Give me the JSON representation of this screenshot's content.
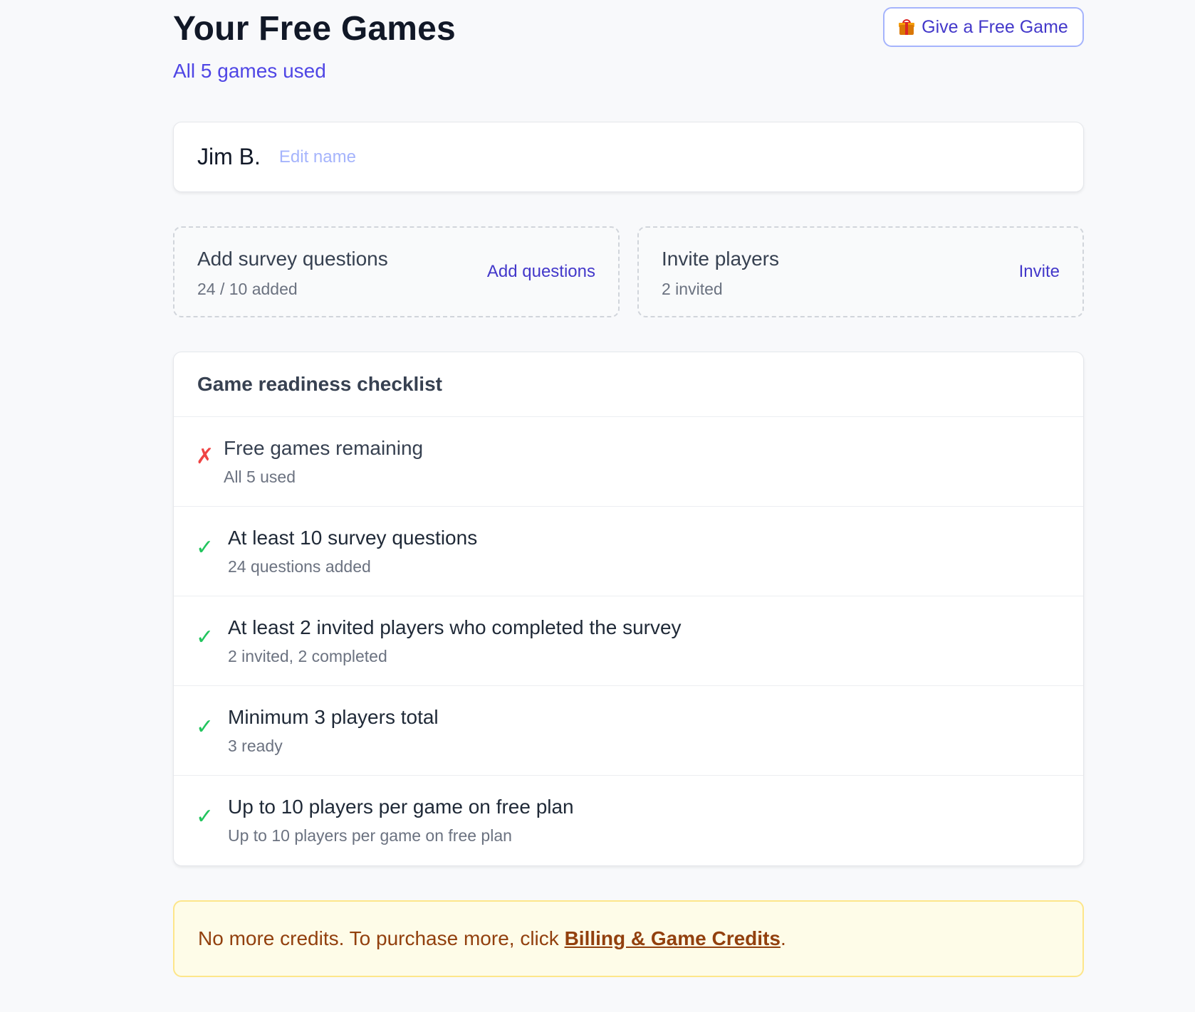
{
  "header": {
    "title": "Your Free Games",
    "subtitle": "All 5 games used",
    "give_button_label": "Give a Free Game",
    "give_button_icon": "gift-icon"
  },
  "player": {
    "name": "Jim B.",
    "edit_label": "Edit name"
  },
  "tiles": [
    {
      "title": "Add survey questions",
      "subtitle": "24 / 10 added",
      "action": "Add questions"
    },
    {
      "title": "Invite players",
      "subtitle": "2 invited",
      "action": "Invite"
    }
  ],
  "checklist": {
    "heading": "Game readiness checklist",
    "items": [
      {
        "status": "fail",
        "mark": "✗",
        "title": "Free games remaining",
        "detail": "All 5 used"
      },
      {
        "status": "pass",
        "mark": "✓",
        "title": "At least 10 survey questions",
        "detail": "24 questions added"
      },
      {
        "status": "pass",
        "mark": "✓",
        "title": "At least 2 invited players who completed the survey",
        "detail": "2 invited, 2 completed"
      },
      {
        "status": "pass",
        "mark": "✓",
        "title": "Minimum 3 players total",
        "detail": "3 ready"
      },
      {
        "status": "pass",
        "mark": "✓",
        "title": "Up to 10 players per game on free plan",
        "detail": "Up to 10 players per game on free plan"
      }
    ]
  },
  "notice": {
    "text_before": "No more credits. To purchase more, click ",
    "link_label": "Billing & Game Credits",
    "text_after": "."
  },
  "colors": {
    "accent": "#4f46e5",
    "pass": "#22c55e",
    "fail": "#ef4444",
    "warning_bg": "#fefce8",
    "warning_text": "#92400e"
  }
}
